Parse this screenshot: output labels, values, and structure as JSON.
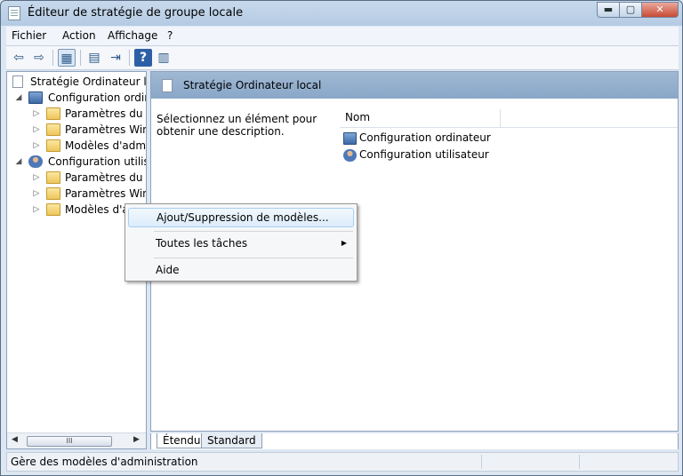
{
  "window": {
    "title": "Éditeur de stratégie de groupe locale",
    "controls": {
      "minimize": "▬",
      "maximize": "▢",
      "close": "✕"
    }
  },
  "menubar": {
    "items": [
      "Fichier",
      "Action",
      "Affichage",
      "?"
    ]
  },
  "toolbar": {
    "back_icon": "⇦",
    "forward_icon": "⇨",
    "view_icon": "▦",
    "properties_icon": "▤",
    "export_icon": "⇥",
    "help_icon": "?",
    "panel_icon": "▥"
  },
  "tree": {
    "root": "Stratégie Ordinateur local",
    "computer": {
      "label": "Configuration ordinateur",
      "children": [
        "Paramètres du logiciel",
        "Paramètres Windows",
        "Modèles d'administration"
      ]
    },
    "user": {
      "label": "Configuration utilisateur",
      "children": [
        "Paramètres du logiciel",
        "Paramètres Windows",
        "Modèles d'administration"
      ]
    },
    "expander_open": "◢",
    "expander_closed": "▷",
    "scroll": {
      "left": "◀",
      "right": "▶",
      "grip": "III"
    }
  },
  "right_pane": {
    "header": "Stratégie Ordinateur local",
    "description": "Sélectionnez un élément pour obtenir une description.",
    "column_name": "Nom",
    "items": [
      "Configuration ordinateur",
      "Configuration utilisateur"
    ]
  },
  "tabs": [
    "Étendu",
    "Standard"
  ],
  "status": {
    "text": "Gère des modèles d'administration"
  },
  "context_menu": {
    "items": [
      {
        "label": "Ajout/Suppression de modèles..."
      },
      {
        "label": "Toutes les tâches",
        "submenu_arrow": "▶"
      },
      {
        "label": "Aide"
      }
    ]
  }
}
